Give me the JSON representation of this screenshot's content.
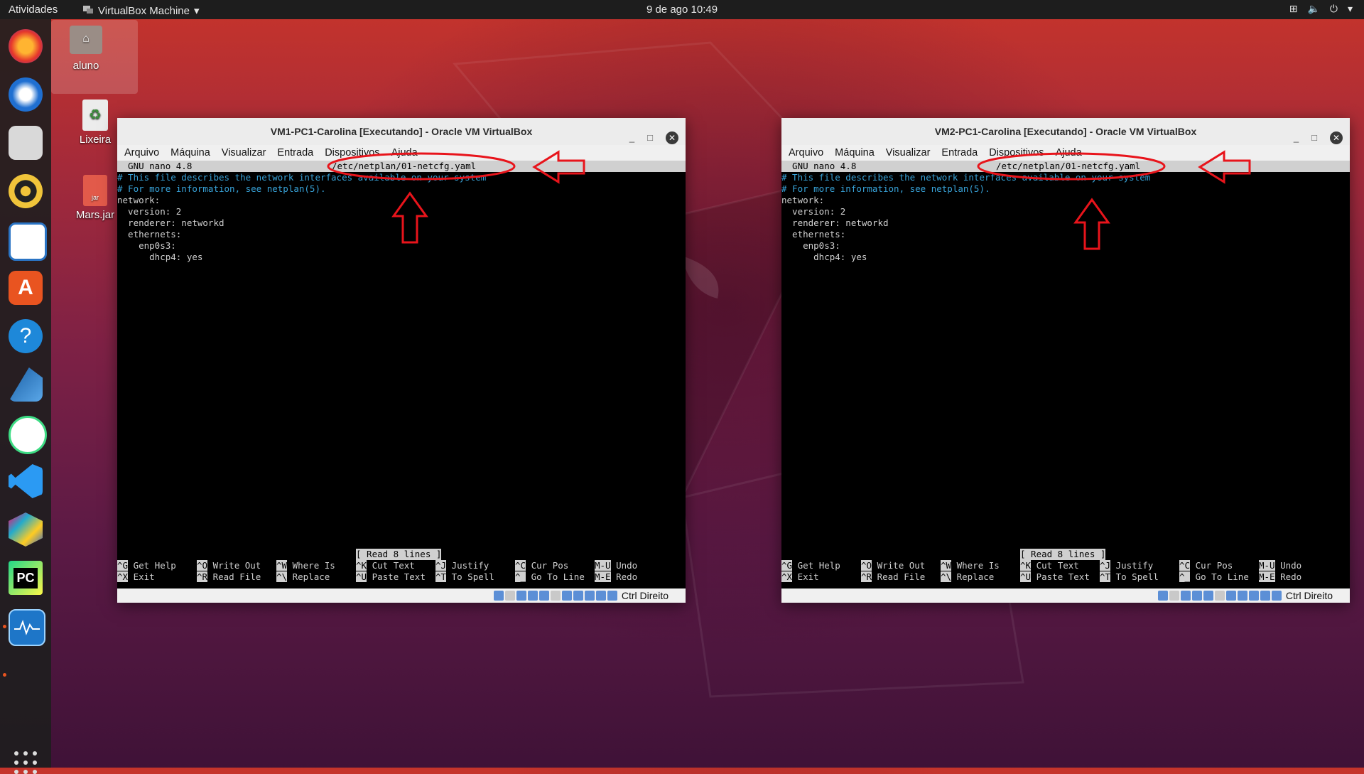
{
  "topbar": {
    "activities": "Atividades",
    "app_name": "VirtualBox Machine",
    "clock": "9 de ago  10:49"
  },
  "desktop": {
    "home_label": "aluno",
    "trash_label": "Lixeira",
    "jar_label": "Mars.jar",
    "jar_badge": "jar"
  },
  "dock": {
    "items": [
      "firefox-icon",
      "thunderbird-icon",
      "files-icon",
      "rhythmbox-icon",
      "libreoffice-writer-icon",
      "software-center-icon",
      "help-icon",
      "wireshark-icon",
      "android-studio-icon",
      "vscode-icon",
      "virtualbox-icon",
      "pycharm-icon",
      "system-monitor-icon"
    ],
    "pycharm_text": "PC"
  },
  "vm1": {
    "title": "VM1-PC1-Carolina [Executando] - Oracle VM VirtualBox",
    "menu": [
      "Arquivo",
      "Máquina",
      "Visualizar",
      "Entrada",
      "Dispositivos",
      "Ajuda"
    ],
    "header_left": "  GNU nano 4.8",
    "header_file": "/etc/netplan/01-netcfg.yaml",
    "lines": [
      "# This file describes the network interfaces available on your system",
      "# For more information, see netplan(5).",
      "network:",
      "  version: 2",
      "  renderer: networkd",
      "  ethernets:",
      "    enp0s3:",
      "      dhcp4: yes"
    ],
    "status": "[ Read 8 lines ]",
    "shortcuts": [
      {
        "k1": "^G",
        "l1": "Get Help",
        "k2": "^X",
        "l2": "Exit"
      },
      {
        "k1": "^O",
        "l1": "Write Out",
        "k2": "^R",
        "l2": "Read File"
      },
      {
        "k1": "^W",
        "l1": "Where Is",
        "k2": "^\\",
        "l2": "Replace"
      },
      {
        "k1": "^K",
        "l1": "Cut Text",
        "k2": "^U",
        "l2": "Paste Text"
      },
      {
        "k1": "^J",
        "l1": "Justify",
        "k2": "^T",
        "l2": "To Spell"
      },
      {
        "k1": "^C",
        "l1": "Cur Pos",
        "k2": "^_",
        "l2": "Go To Line"
      },
      {
        "k1": "M-U",
        "l1": "Undo",
        "k2": "M-E",
        "l2": "Redo"
      }
    ],
    "hostkey": "Ctrl Direito"
  },
  "vm2": {
    "title": "VM2-PC1-Carolina [Executando] - Oracle VM VirtualBox",
    "menu": [
      "Arquivo",
      "Máquina",
      "Visualizar",
      "Entrada",
      "Dispositivos",
      "Ajuda"
    ],
    "header_left": "  GNU nano 4.8",
    "header_file": "/etc/netplan/01-netcfg.yaml",
    "lines": [
      "# This file describes the network interfaces available on your system",
      "# For more information, see netplan(5).",
      "network:",
      "  version: 2",
      "  renderer: networkd",
      "  ethernets:",
      "    enp0s3:",
      "      dhcp4: yes"
    ],
    "status": "[ Read 8 lines ]",
    "shortcuts": [
      {
        "k1": "^G",
        "l1": "Get Help",
        "k2": "^X",
        "l2": "Exit"
      },
      {
        "k1": "^O",
        "l1": "Write Out",
        "k2": "^R",
        "l2": "Read File"
      },
      {
        "k1": "^W",
        "l1": "Where Is",
        "k2": "^\\",
        "l2": "Replace"
      },
      {
        "k1": "^K",
        "l1": "Cut Text",
        "k2": "^U",
        "l2": "Paste Text"
      },
      {
        "k1": "^J",
        "l1": "Justify",
        "k2": "^T",
        "l2": "To Spell"
      },
      {
        "k1": "^C",
        "l1": "Cur Pos",
        "k2": "^_",
        "l2": "Go To Line"
      },
      {
        "k1": "M-U",
        "l1": "Undo",
        "k2": "M-E",
        "l2": "Redo"
      }
    ],
    "hostkey": "Ctrl Direito"
  },
  "colors": {
    "annotation": "#e8141b",
    "accent": "#e95420"
  }
}
